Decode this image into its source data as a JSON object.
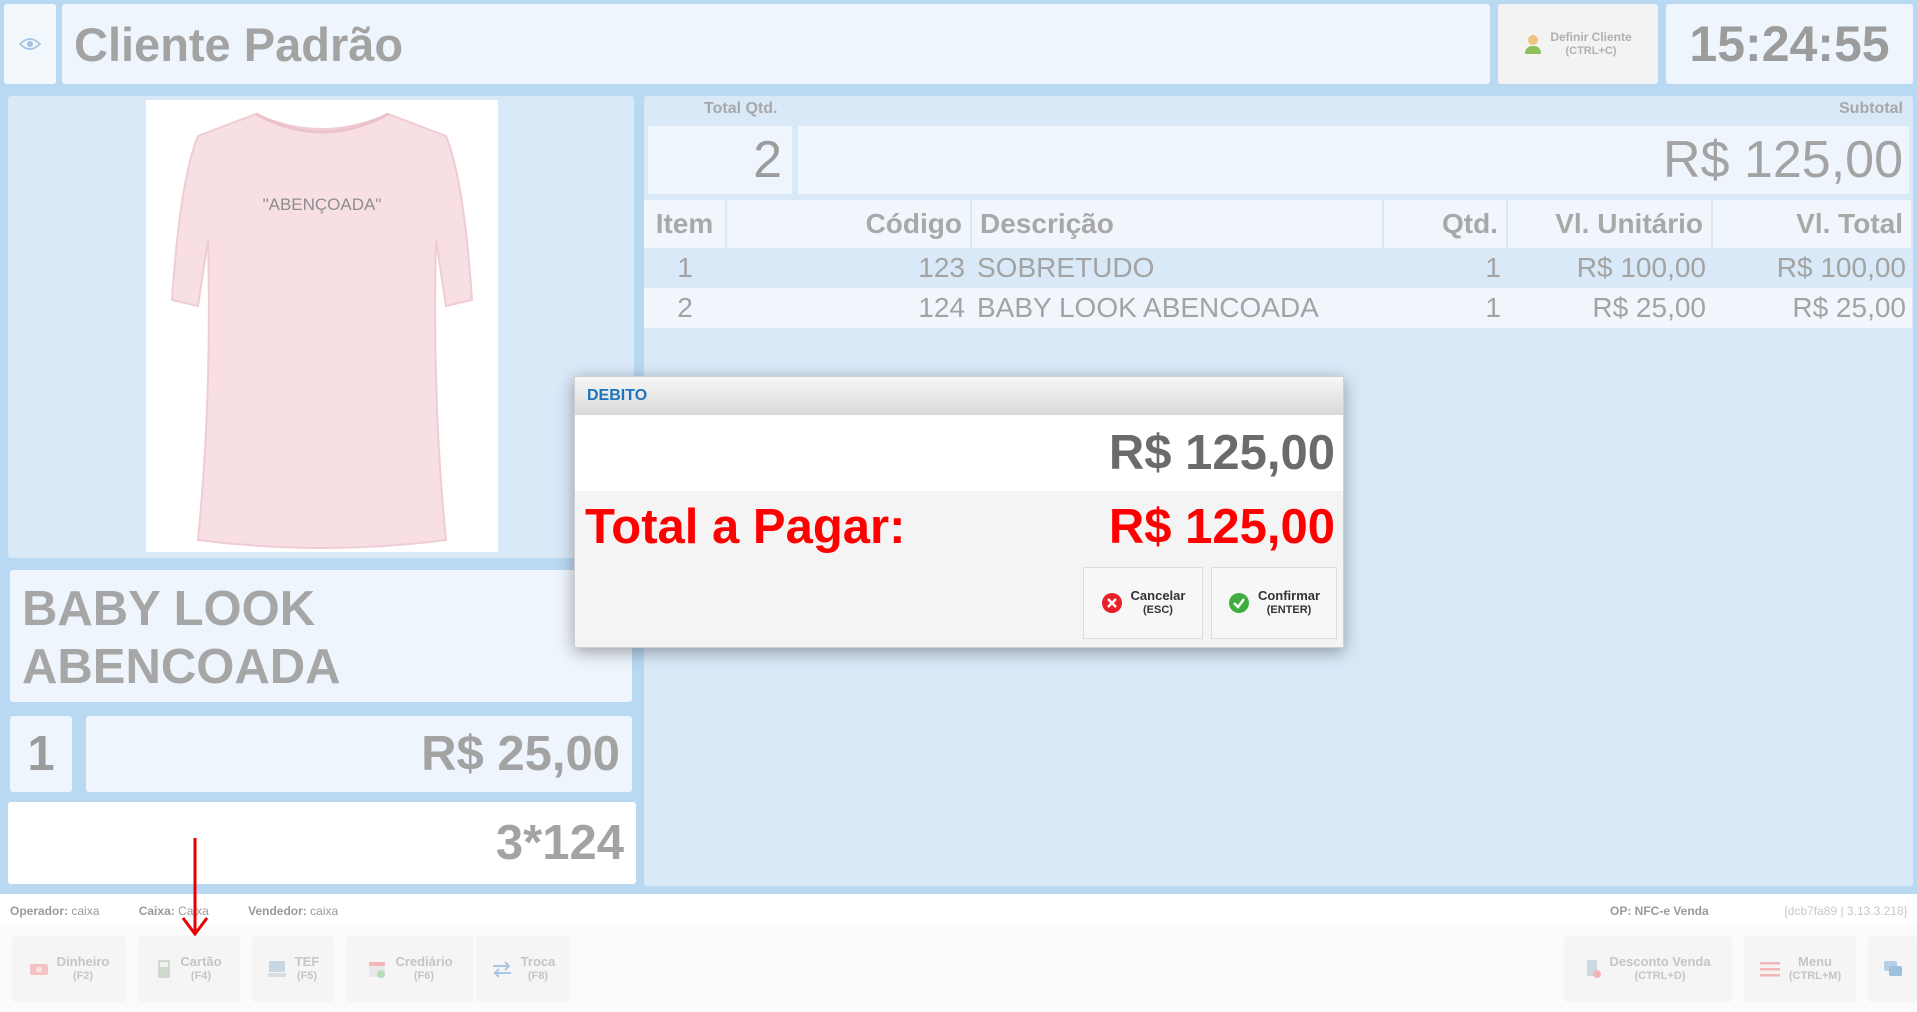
{
  "header": {
    "client_name": "Cliente Padrão",
    "define_client_label": "Definir Cliente",
    "define_client_shortcut": "(CTRL+C)",
    "clock": "15:24:55"
  },
  "product": {
    "shirt_print": "\"ABENÇOADA\"",
    "name": "BABY LOOK ABENCOADA",
    "qty": "1",
    "price": "R$ 25,00",
    "entry": "3*124"
  },
  "totals": {
    "total_qty_label": "Total Qtd.",
    "total_qty": "2",
    "subtotal_label": "Subtotal",
    "subtotal": "R$ 125,00"
  },
  "table": {
    "headers": [
      "Item",
      "Código",
      "Descrição",
      "Qtd.",
      "Vl. Unitário",
      "Vl. Total"
    ],
    "rows": [
      [
        "1",
        "123",
        "SOBRETUDO",
        "1",
        "R$ 100,00",
        "R$ 100,00"
      ],
      [
        "2",
        "124",
        "BABY LOOK ABENCOADA",
        "1",
        "R$ 25,00",
        "R$ 25,00"
      ]
    ]
  },
  "status": {
    "operator_label": "Operador:",
    "operator": "caixa",
    "cashier_label": "Caixa:",
    "cashier": "Caixa",
    "seller_label": "Vendedor:",
    "seller": "caixa",
    "op": "OP: NFC-e Venda",
    "version": "[dcb7fa89 | 3.13.3.218]"
  },
  "toolbar": {
    "dinheiro": {
      "label": "Dinheiro",
      "shortcut": "(F2)"
    },
    "cartao": {
      "label": "Cartão",
      "shortcut": "(F4)"
    },
    "tef": {
      "label": "TEF",
      "shortcut": "(F5)"
    },
    "crediario": {
      "label": "Crediário",
      "shortcut": "(F6)"
    },
    "troca": {
      "label": "Troca",
      "shortcut": "(F8)"
    },
    "desconto": {
      "label": "Desconto Venda",
      "shortcut": "(CTRL+D)"
    },
    "menu": {
      "label": "Menu",
      "shortcut": "(CTRL+M)"
    }
  },
  "modal": {
    "title": "DEBITO",
    "amount": "R$ 125,00",
    "total_label": "Total a Pagar:",
    "total_value": "R$ 125,00",
    "cancel_label": "Cancelar",
    "cancel_shortcut": "(ESC)",
    "confirm_label": "Confirmar",
    "confirm_shortcut": "(ENTER)"
  },
  "colors": {
    "background": "#b9d8f2",
    "modal_title": "#1e73be",
    "total_red": "#ff0000",
    "cancel_icon": "#e8202a",
    "confirm_icon": "#3fae3f",
    "arrow": "#e60000"
  }
}
